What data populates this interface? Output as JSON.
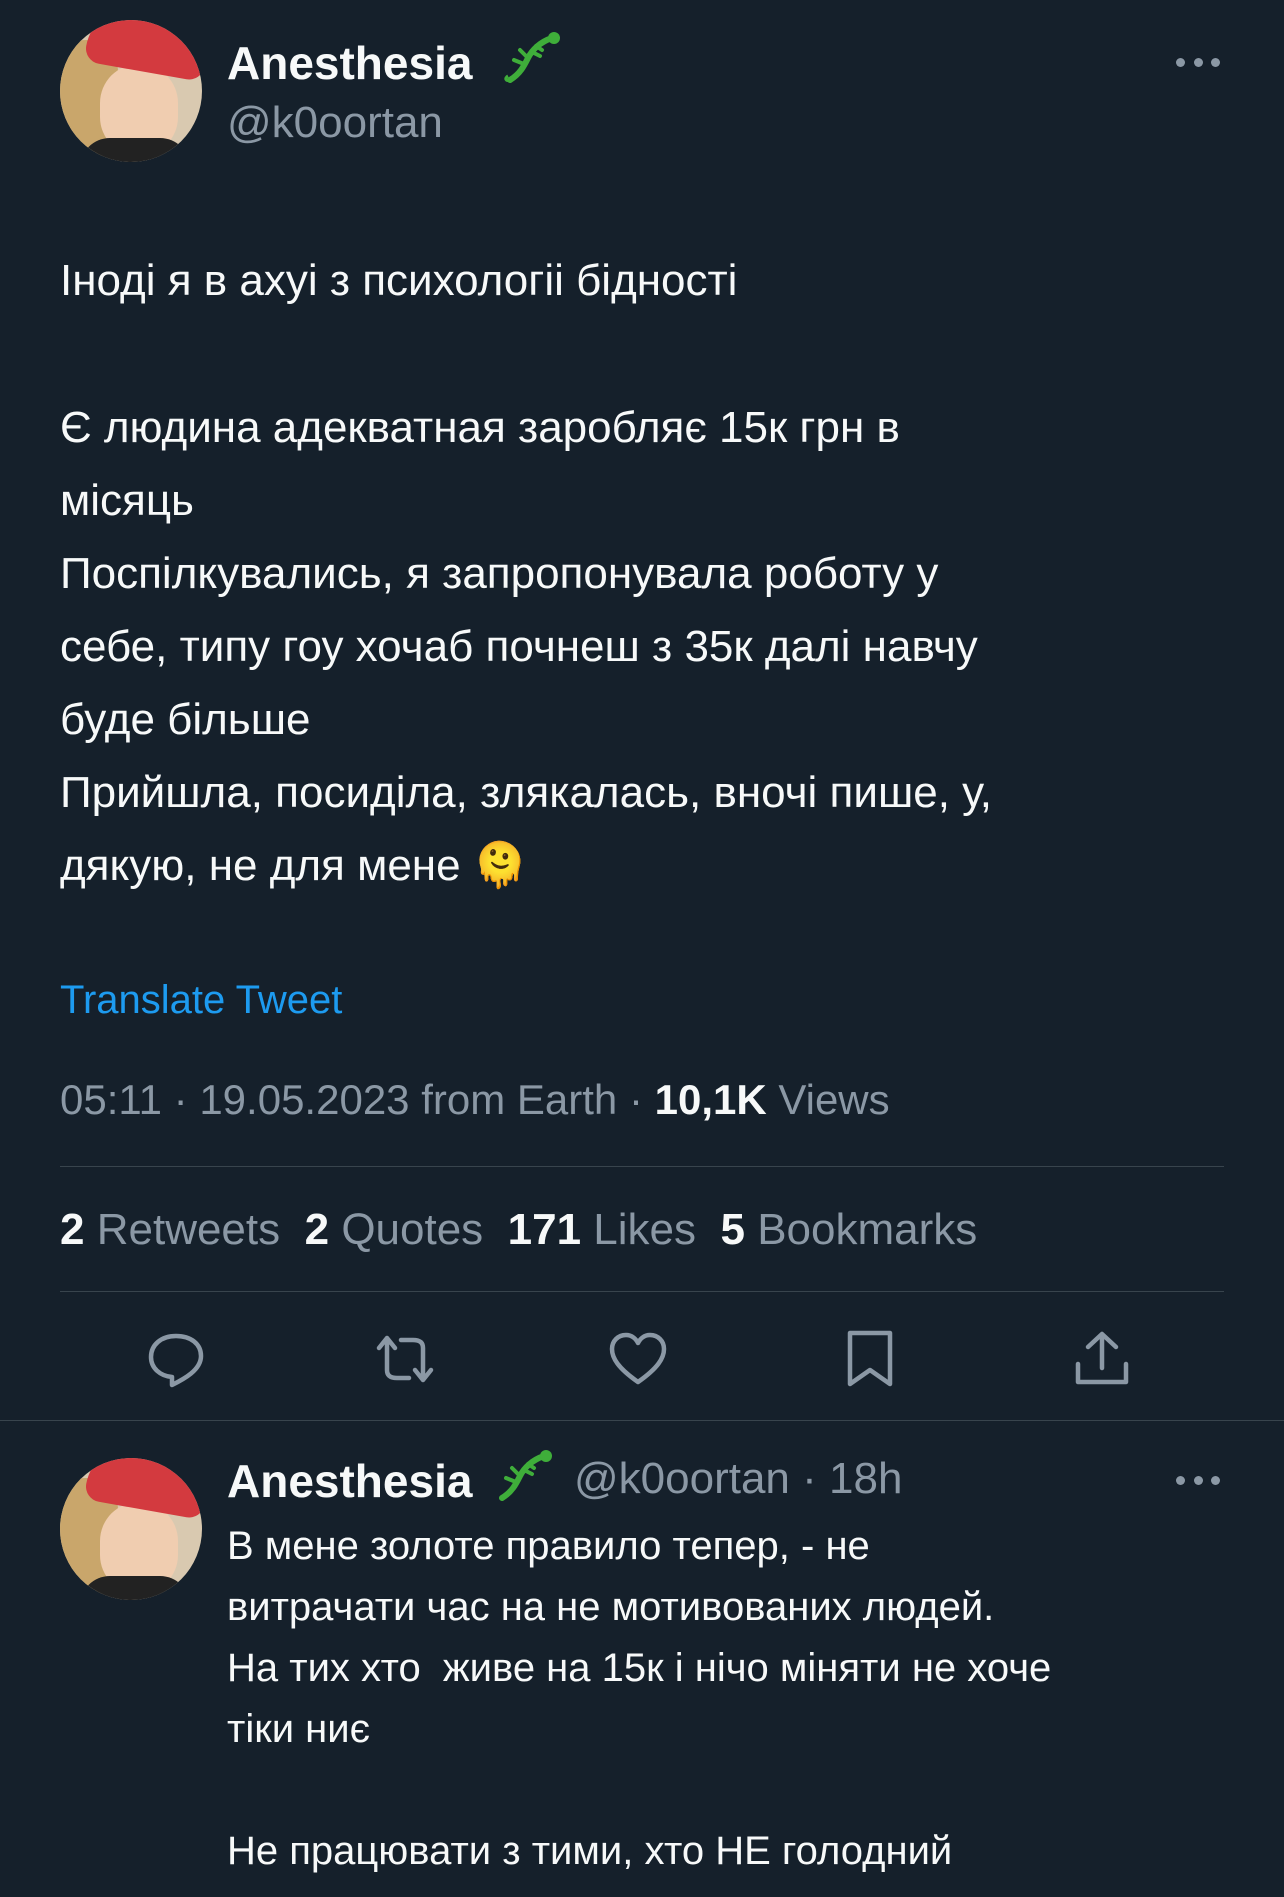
{
  "tweet": {
    "author_name": "Anesthesia",
    "author_handle": "@k0oortan",
    "line1": "Іноді я в ахуі з психологіі бідності",
    "body": "Є людина адекватная заробляє 15к грн в\nмісяць\nПоспілкувались, я запропонувала роботу у\nсебе, типу гоу хочаб почнеш з 35к далі навчу\nбуде більше\nПрийшла, посиділа, злякалась, вночі пише, у,\nдякую, не для мене",
    "emoji": "🫠",
    "translate_label": "Translate Tweet",
    "time": "05:11",
    "date": "19.05.2023",
    "source": "from Earth",
    "views_count": "10,1K",
    "views_label": "Views",
    "stats": {
      "retweets_count": "2",
      "retweets_label": "Retweets",
      "quotes_count": "2",
      "quotes_label": "Quotes",
      "likes_count": "171",
      "likes_label": "Likes",
      "bookmarks_count": "5",
      "bookmarks_label": "Bookmarks"
    }
  },
  "reply": {
    "author_name": "Anesthesia",
    "author_handle": "@k0oortan",
    "time_ago": "18h",
    "text": "В мене золоте правило тепер, - не\nвитрачати час на не мотивованих людей.\nНа тих хто  живе на 15к і нічо міняти не хоче\nтіки ниє\n\nНе працювати з тими, хто НЕ голодний"
  },
  "icons": {
    "emoji_badge": "lizard-icon",
    "more": "more-icon",
    "reply": "reply-icon",
    "retweet": "retweet-icon",
    "like": "heart-icon",
    "bookmark": "bookmark-icon",
    "share": "share-icon"
  },
  "colors": {
    "background": "#15202b",
    "text": "#f7f9f9",
    "secondary": "#8b98a5",
    "accent": "#1d9bf0",
    "divider": "#38444d"
  }
}
